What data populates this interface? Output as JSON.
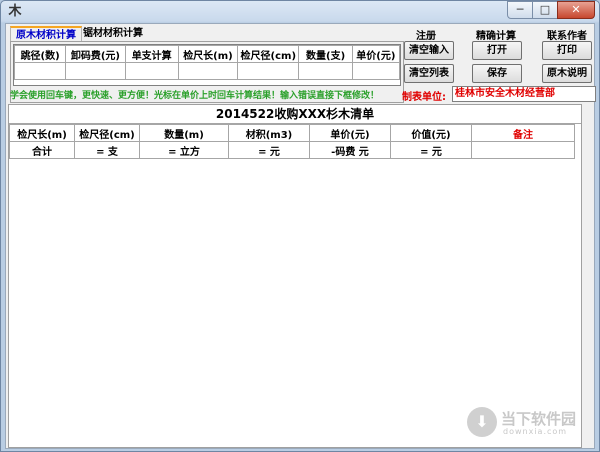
{
  "window": {
    "title": "",
    "app_icon": "木",
    "controls": {
      "minimize": "─",
      "maximize": "□",
      "close": "✕"
    }
  },
  "tabs": [
    {
      "label": "原木材积计算",
      "active": true
    },
    {
      "label": "锯材材积计算",
      "active": false
    }
  ],
  "input_grid": {
    "columns": [
      "跳径(数)",
      "卸码费(元)",
      "单支计算",
      "检尺长(m)",
      "检尺径(cm)",
      "数量(支)",
      "单价(元)"
    ],
    "rows": [
      [
        "",
        "",
        "",
        "",
        "",
        "",
        ""
      ]
    ]
  },
  "sections": {
    "register": "注册",
    "precise": "精确计算",
    "contact": "联系作者"
  },
  "buttons": {
    "clear_input": "清空输入",
    "open": "打开",
    "print": "打印",
    "clear_list": "清空列表",
    "save": "保存",
    "log_help": "原木说明"
  },
  "hint": "学会使用回车键，更快速、更方便！光标在单价上时回车计算结果！输入错误直接下框修改！",
  "unit": {
    "label": "制表单位:",
    "value": "桂林市安全木材经营部"
  },
  "sheet": {
    "title": "2014522收购XXX杉木清单",
    "columns": [
      "检尺长(m)",
      "检尺径(cm)",
      "数量(m)",
      "材积(m3)",
      "单价(元)",
      "价值(元)",
      "备注"
    ],
    "total_row": [
      "合计",
      "= 支",
      "= 立方",
      "= 元",
      "-码费 元",
      "= 元",
      ""
    ]
  },
  "watermark": {
    "name": "当下软件园",
    "url": "downxia.com",
    "icon": "download-icon"
  }
}
